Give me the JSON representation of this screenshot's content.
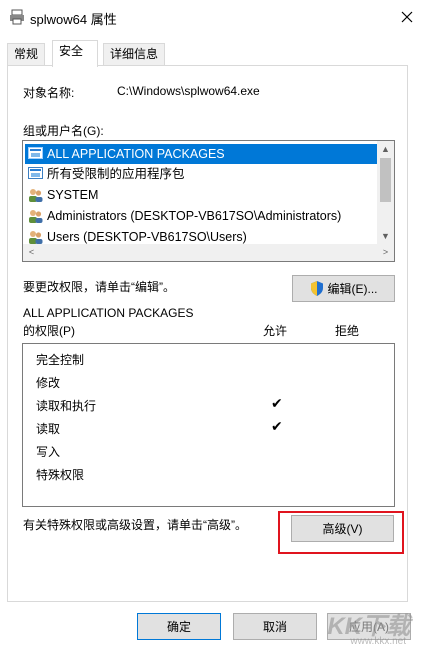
{
  "window": {
    "title": "splwow64 属性"
  },
  "tabs": [
    {
      "label": "常规"
    },
    {
      "label": "安全"
    },
    {
      "label": "详细信息"
    }
  ],
  "object": {
    "label": "对象名称:",
    "value": "C:\\Windows\\splwow64.exe"
  },
  "groups": {
    "label": "组或用户名(G):",
    "items": [
      {
        "label": "ALL APPLICATION PACKAGES",
        "icon": "app-package-icon",
        "selected": true
      },
      {
        "label": "所有受限制的应用程序包",
        "icon": "app-package-icon",
        "selected": false
      },
      {
        "label": "SYSTEM",
        "icon": "users-icon",
        "selected": false
      },
      {
        "label": "Administrators (DESKTOP-VB617SO\\Administrators)",
        "icon": "users-icon",
        "selected": false
      },
      {
        "label": "Users (DESKTOP-VB617SO\\Users)",
        "icon": "users-icon",
        "selected": false
      }
    ]
  },
  "edit": {
    "hint": "要更改权限，请单击“编辑”。",
    "button": "编辑(E)..."
  },
  "permissions": {
    "for_label": "ALL APPLICATION PACKAGES",
    "label": "的权限(P)",
    "allow": "允许",
    "deny": "拒绝",
    "rows": [
      {
        "name": "完全控制",
        "allow": false,
        "deny": false
      },
      {
        "name": "修改",
        "allow": false,
        "deny": false
      },
      {
        "name": "读取和执行",
        "allow": true,
        "deny": false
      },
      {
        "name": "读取",
        "allow": true,
        "deny": false
      },
      {
        "name": "写入",
        "allow": false,
        "deny": false
      },
      {
        "name": "特殊权限",
        "allow": false,
        "deny": false
      }
    ]
  },
  "advanced": {
    "hint": "有关特殊权限或高级设置，请单击“高级”。",
    "button": "高级(V)"
  },
  "footer": {
    "ok": "确定",
    "cancel": "取消",
    "apply": "应用(A)"
  },
  "watermark": {
    "text": "KK下载",
    "sub": "www.kkx.net"
  },
  "colors": {
    "selection": "#0078d7",
    "highlight_box": "#e0141e"
  }
}
